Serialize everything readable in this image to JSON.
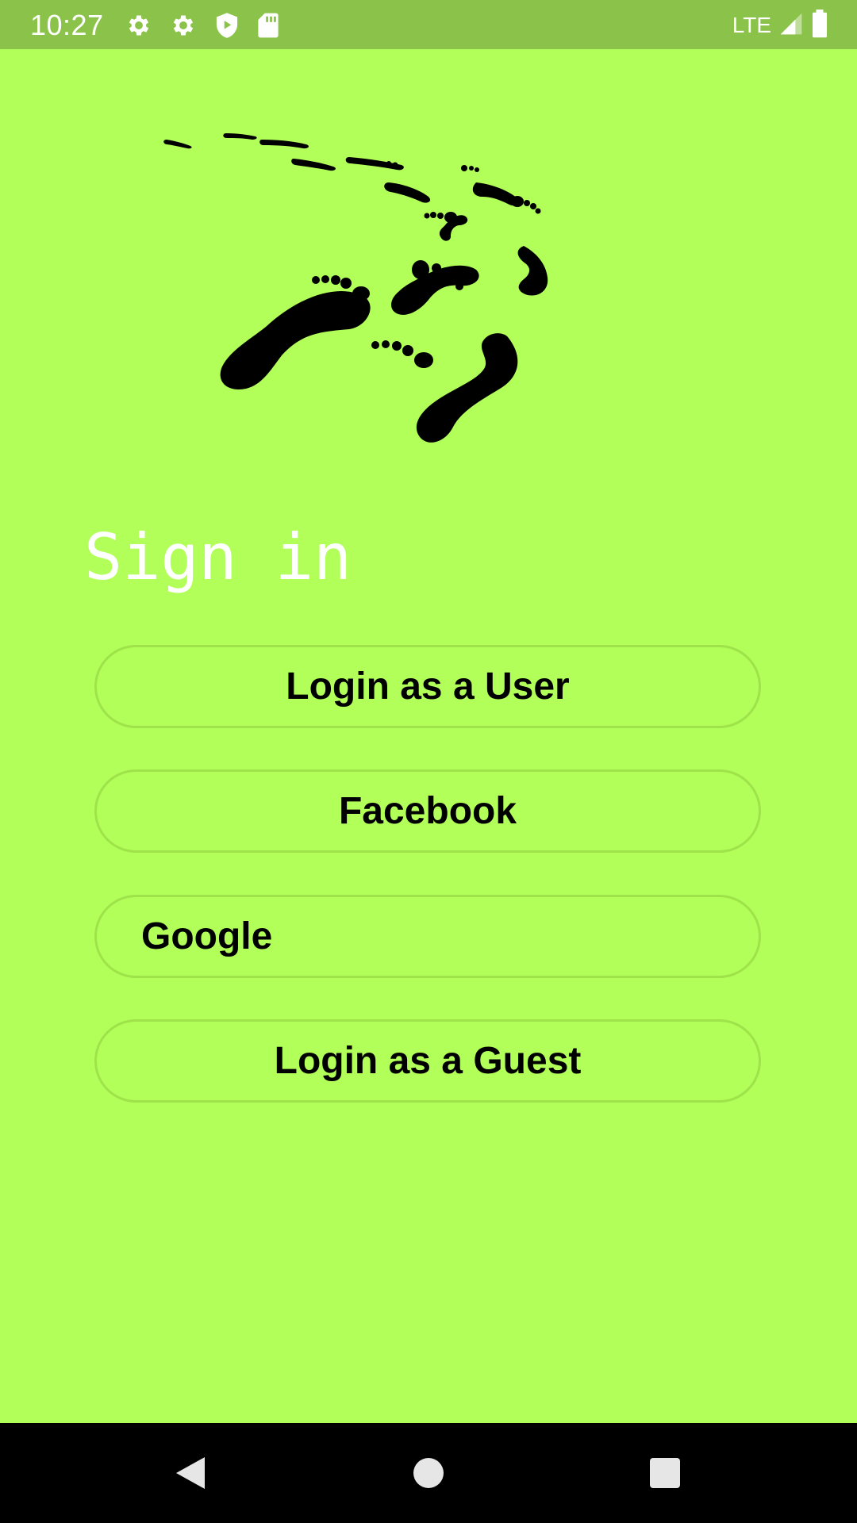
{
  "status_bar": {
    "time": "10:27",
    "network": "LTE",
    "icons": [
      "settings-icon",
      "settings-icon",
      "shield-play-icon",
      "sd-card-icon",
      "signal-icon",
      "battery-icon"
    ]
  },
  "logo": {
    "icon": "footprints-icon",
    "color": "#000000"
  },
  "title": "Sign in",
  "buttons": {
    "user": "Login as a User",
    "facebook": "Facebook",
    "google": "Google",
    "guest": "Login as a Guest"
  },
  "colors": {
    "background": "#b2ff59",
    "status_bar": "#8bc34a",
    "button_border": "#9ee34a",
    "title": "#ffffff"
  },
  "nav_bar": {
    "icons": [
      "back-icon",
      "home-icon",
      "recents-icon"
    ]
  }
}
